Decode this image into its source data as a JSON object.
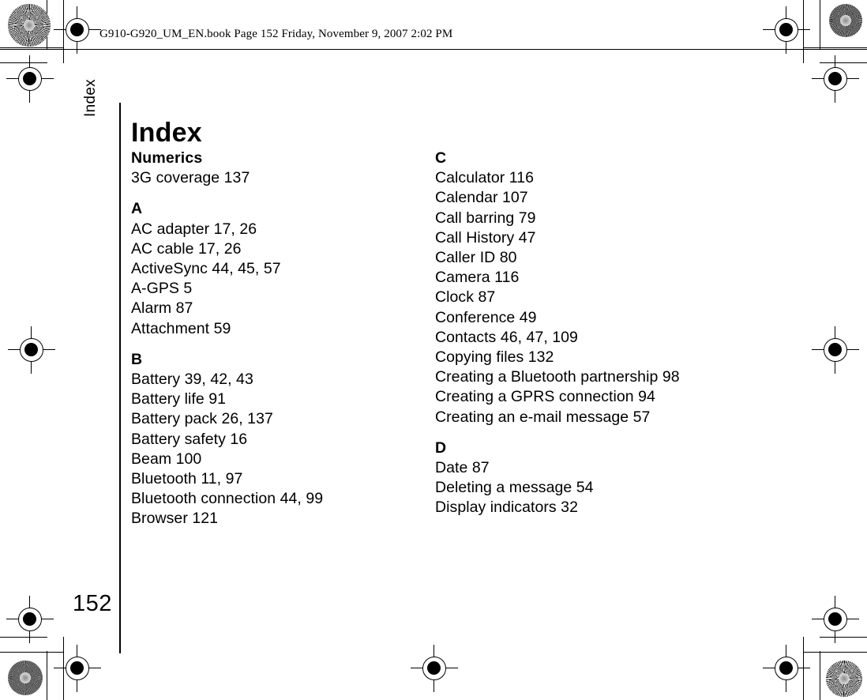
{
  "header": {
    "book_line": "G910-G920_UM_EN.book  Page 152  Friday, November 9, 2007  2:02 PM"
  },
  "chapter_tab": {
    "label": "Index"
  },
  "page": {
    "number": "152",
    "title": "Index"
  },
  "index": {
    "left_column": [
      {
        "letter": "Numerics",
        "entries": [
          "3G coverage 137"
        ]
      },
      {
        "letter": "A",
        "entries": [
          "AC adapter 17, 26",
          "AC cable 17, 26",
          "ActiveSync 44, 45, 57",
          "A-GPS 5",
          "Alarm 87",
          "Attachment 59"
        ]
      },
      {
        "letter": "B",
        "entries": [
          "Battery 39, 42, 43",
          "Battery life 91",
          "Battery pack 26, 137",
          "Battery safety 16",
          "Beam 100",
          "Bluetooth 11, 97",
          "Bluetooth connection 44, 99",
          "Browser 121"
        ]
      }
    ],
    "right_column": [
      {
        "letter": "C",
        "entries": [
          "Calculator 116",
          "Calendar 107",
          "Call barring 79",
          "Call History 47",
          "Caller ID 80",
          "Camera 116",
          "Clock 87",
          "Conference 49",
          "Contacts 46, 47, 109",
          "Copying files 132",
          "Creating a Bluetooth partnership 98",
          "Creating a GPRS connection 94",
          "Creating an e-mail message 57"
        ]
      },
      {
        "letter": "D",
        "entries": [
          "Date 87",
          "Deleting a message 54",
          "Display indicators 32"
        ]
      }
    ]
  },
  "prepress": {
    "colors": {
      "ink": "#000000",
      "page_background": "#ffffff"
    }
  }
}
